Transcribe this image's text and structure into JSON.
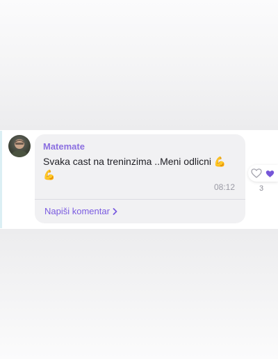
{
  "post": {
    "author": "Matemate",
    "message": "Svaka cast na treninzima ..Meni odlicni 💪 💪",
    "time": "08:12",
    "comment_link": "Napiši komentar",
    "like_count": "3"
  },
  "colors": {
    "author": "#8b6fe0",
    "link": "#7a5be0",
    "heart": "#7656d8",
    "bubble": "#f1f1f3"
  },
  "icons": {
    "comment_chevron": "chevron-right-icon",
    "like_outline": "heart-outline-icon",
    "like_filled": "heart-filled-icon"
  }
}
